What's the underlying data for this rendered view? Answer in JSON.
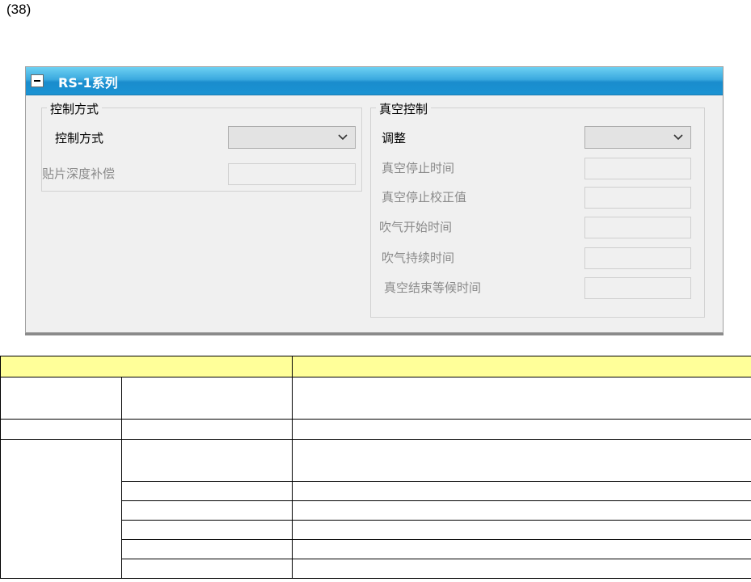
{
  "figure_label": "(38)",
  "panel": {
    "title": "RS-1系列",
    "control_group": {
      "legend": "控制方式",
      "rows": [
        {
          "label": "控制方式",
          "type": "combo",
          "enabled": true,
          "value": ""
        },
        {
          "label": "贴片深度补偿",
          "type": "text",
          "enabled": false,
          "value": ""
        }
      ]
    },
    "vacuum_group": {
      "legend": "真空控制",
      "rows": [
        {
          "label": "调整",
          "type": "combo",
          "enabled": true,
          "value": ""
        },
        {
          "label": "真空停止时间",
          "type": "text",
          "enabled": false,
          "value": ""
        },
        {
          "label": "真空停止校正值",
          "type": "text",
          "enabled": false,
          "value": ""
        },
        {
          "label": "吹气开始时间",
          "type": "text",
          "enabled": false,
          "value": ""
        },
        {
          "label": "吹气持续时间",
          "type": "text",
          "enabled": false,
          "value": ""
        },
        {
          "label": "真空结束等候时间",
          "type": "text",
          "enabled": false,
          "value": ""
        }
      ]
    }
  },
  "table": {
    "header_color": "#ffff99",
    "header": [
      "",
      ""
    ],
    "rows": []
  }
}
